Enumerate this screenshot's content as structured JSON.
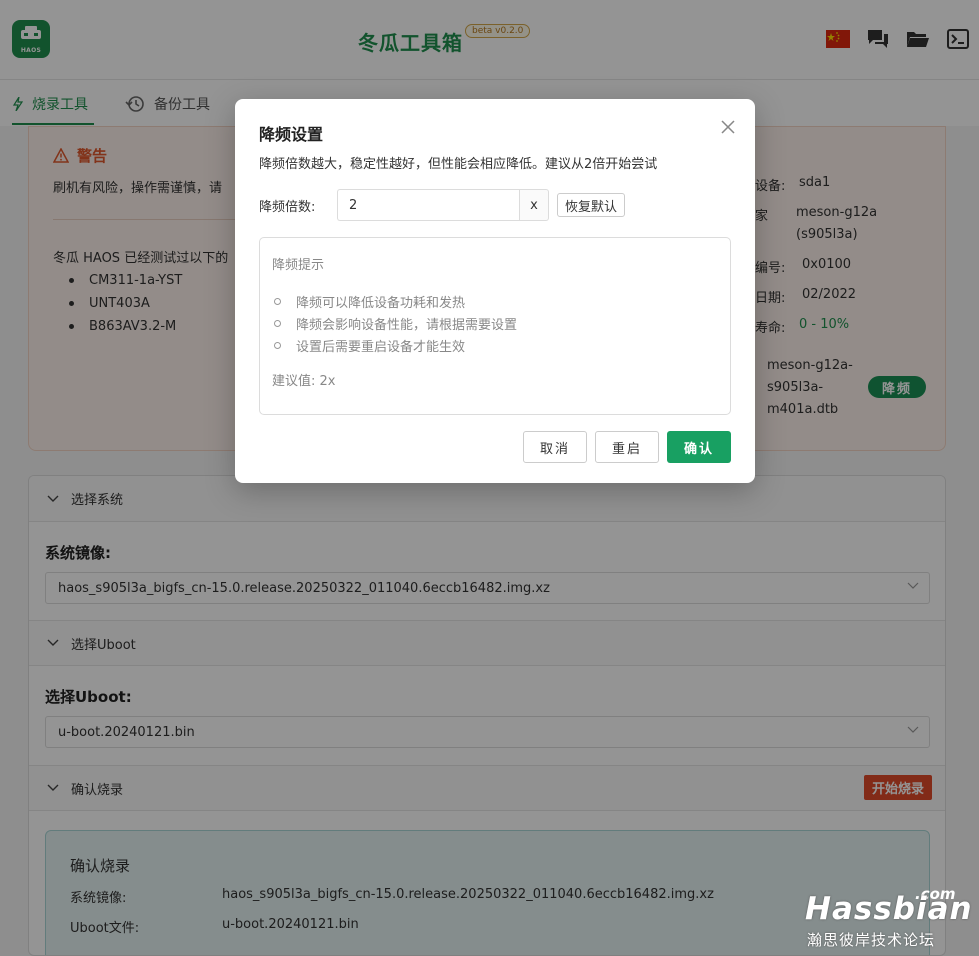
{
  "header": {
    "logo_text": "HAOS",
    "app_title": "冬瓜工具箱",
    "version": "beta v0.2.0",
    "icons": [
      "china-flag-icon",
      "chat-icon",
      "folder-icon",
      "terminal-icon"
    ]
  },
  "tabs": [
    {
      "label": "烧录工具",
      "icon": "lightning-icon",
      "active": true
    },
    {
      "label": "备份工具",
      "icon": "history-icon",
      "active": false
    }
  ],
  "warning": {
    "title": "警告",
    "text": "刷机有风险，操作需谨慎，请",
    "tested_text": "冬瓜 HAOS 已经测试过以下的",
    "devices": [
      "CM311-1a-YST",
      "UNT403A",
      "B863AV3.2-M"
    ]
  },
  "device_info": {
    "device_label": "设备:",
    "device_value": "sda1",
    "family_label": "家",
    "family_value_1": "meson-g12a",
    "family_value_2": "(s905l3a)",
    "serial_label": "编号:",
    "serial_value": "0x0100",
    "date_label": "日期:",
    "date_value": "02/2022",
    "life_label": "寿命:",
    "life_value": "0 - 10%",
    "dtb_1": "meson-g12a-",
    "dtb_2": "s905l3a-",
    "dtb_3": "m401a.dtb",
    "downclock_button": "降频"
  },
  "sections": {
    "system": {
      "header": "选择系统",
      "label": "系统镜像:",
      "selected": "haos_s905l3a_bigfs_cn-15.0.release.20250322_011040.6eccb16482.img.xz"
    },
    "uboot": {
      "header": "选择Uboot",
      "label": "选择Uboot:",
      "selected": "u-boot.20240121.bin"
    },
    "confirm": {
      "header": "确认烧录",
      "start_button": "开始烧录",
      "box_title": "确认烧录",
      "image_key": "系统镜像:",
      "image_value": "haos_s905l3a_bigfs_cn-15.0.release.20250322_011040.6eccb16482.img.xz",
      "uboot_key": "Uboot文件:",
      "uboot_value": "u-boot.20240121.bin"
    }
  },
  "modal": {
    "title": "降频设置",
    "description": "降频倍数越大，稳定性越好，但性能会相应降低。建议从2倍开始尝试",
    "factor_label": "降频倍数:",
    "factor_value": "2",
    "factor_suffix": "x",
    "reset_default": "恢复默认",
    "hint_title": "降频提示",
    "hints": [
      "降频可以降低设备功耗和发热",
      "降频会影响设备性能，请根据需要设置",
      "设置后需要重启设备才能生效"
    ],
    "suggest": "建议值: 2x",
    "cancel": "取消",
    "restart": "重启",
    "confirm": "确认"
  },
  "watermark": {
    "com": ".com",
    "name": "Hassbian",
    "sub": "瀚思彼岸技术论坛"
  },
  "colors": {
    "brand_green": "#1f8f4e",
    "confirm_green": "#18a062",
    "danger_orange": "#e14b2a",
    "warning_bg": "#fdf2ec"
  }
}
